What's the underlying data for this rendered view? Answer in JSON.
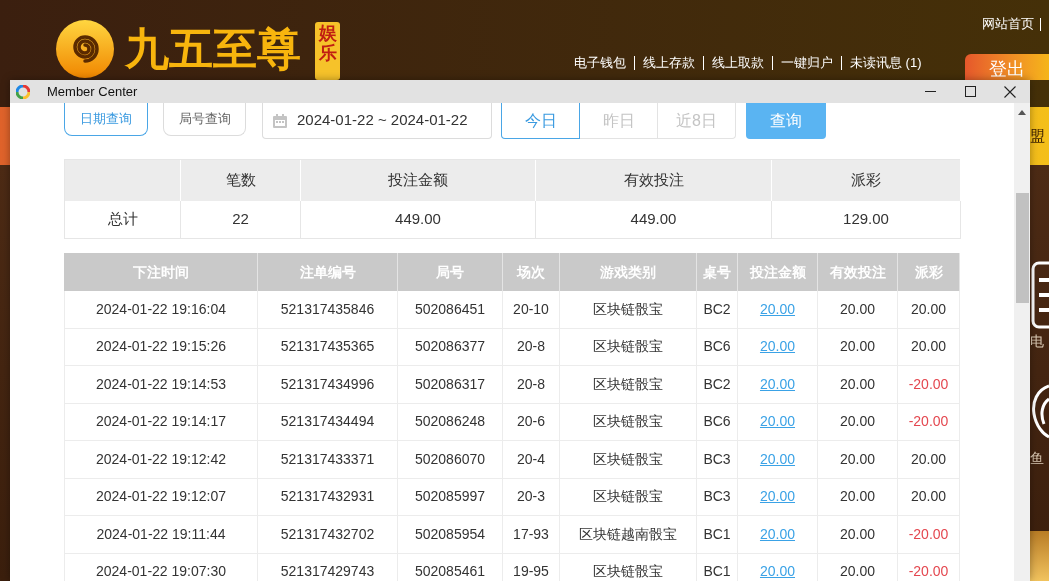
{
  "site": {
    "logo_name": "九五至尊",
    "logo_tag": "娱乐",
    "top_links": [
      "网站首页"
    ],
    "nav_links": [
      "电子钱包",
      "线上存款",
      "线上取款",
      "一键归户",
      "未读讯息 (1)"
    ],
    "logout_button": "登出",
    "nav_bar_item": "盟",
    "side_menu": [
      "电",
      "鱼"
    ]
  },
  "window": {
    "title": "Member Center"
  },
  "query_modes": [
    {
      "label": "日期查询",
      "selected": true
    },
    {
      "label": "局号查询",
      "selected": false
    }
  ],
  "date_range": {
    "value": "2024-01-22 ~ 2024-01-22"
  },
  "quick_ranges": [
    {
      "label": "今日",
      "selected": true
    },
    {
      "label": "昨日",
      "selected": false
    },
    {
      "label": "近8日",
      "selected": false
    }
  ],
  "search_button": "查询",
  "summary": {
    "columns": [
      "笔数",
      "投注金额",
      "有效投注",
      "派彩"
    ],
    "rows": [
      {
        "label": "总计",
        "cells": [
          "22",
          "449.00",
          "449.00",
          "129.00"
        ]
      }
    ]
  },
  "bets": {
    "columns": [
      "下注时间",
      "注单编号",
      "局号",
      "场次",
      "游戏类别",
      "桌号",
      "投注金额",
      "有效投注",
      "派彩"
    ],
    "rows": [
      {
        "time": "2024-01-22 19:16:04",
        "ticket_no": "521317435846",
        "round_no": "502086451",
        "session": "20-10",
        "game": "区块链骰宝",
        "table_no": "BC2",
        "stake": "20.00",
        "valid_bet": "20.00",
        "payout": "20.00",
        "loss": false
      },
      {
        "time": "2024-01-22 19:15:26",
        "ticket_no": "521317435365",
        "round_no": "502086377",
        "session": "20-8",
        "game": "区块链骰宝",
        "table_no": "BC6",
        "stake": "20.00",
        "valid_bet": "20.00",
        "payout": "20.00",
        "loss": false
      },
      {
        "time": "2024-01-22 19:14:53",
        "ticket_no": "521317434996",
        "round_no": "502086317",
        "session": "20-8",
        "game": "区块链骰宝",
        "table_no": "BC2",
        "stake": "20.00",
        "valid_bet": "20.00",
        "payout": "-20.00",
        "loss": true
      },
      {
        "time": "2024-01-22 19:14:17",
        "ticket_no": "521317434494",
        "round_no": "502086248",
        "session": "20-6",
        "game": "区块链骰宝",
        "table_no": "BC6",
        "stake": "20.00",
        "valid_bet": "20.00",
        "payout": "-20.00",
        "loss": true
      },
      {
        "time": "2024-01-22 19:12:42",
        "ticket_no": "521317433371",
        "round_no": "502086070",
        "session": "20-4",
        "game": "区块链骰宝",
        "table_no": "BC3",
        "stake": "20.00",
        "valid_bet": "20.00",
        "payout": "20.00",
        "loss": false
      },
      {
        "time": "2024-01-22 19:12:07",
        "ticket_no": "521317432931",
        "round_no": "502085997",
        "session": "20-3",
        "game": "区块链骰宝",
        "table_no": "BC3",
        "stake": "20.00",
        "valid_bet": "20.00",
        "payout": "20.00",
        "loss": false
      },
      {
        "time": "2024-01-22 19:11:44",
        "ticket_no": "521317432702",
        "round_no": "502085954",
        "session": "17-93",
        "game": "区块链越南骰宝",
        "table_no": "BC1",
        "stake": "20.00",
        "valid_bet": "20.00",
        "payout": "-20.00",
        "loss": true
      },
      {
        "time": "2024-01-22 19:07:30",
        "ticket_no": "521317429743",
        "round_no": "502085461",
        "session": "19-95",
        "game": "区块链骰宝",
        "table_no": "BC1",
        "stake": "20.00",
        "valid_bet": "20.00",
        "payout": "-20.00",
        "loss": true
      }
    ]
  }
}
